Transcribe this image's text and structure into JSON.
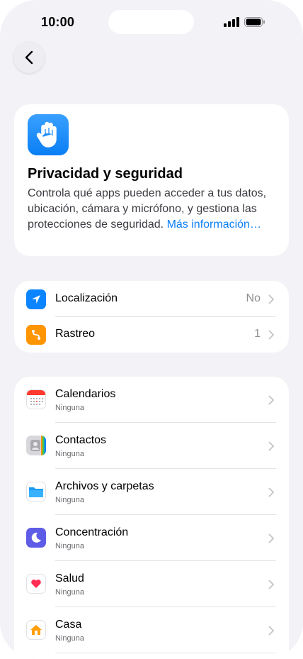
{
  "status": {
    "time": "10:00"
  },
  "hero": {
    "title": "Privacidad y seguridad",
    "description": "Controla qué apps pueden acceder a tus datos, ubicación, cámara y micrófono, y gestiona las protecciones de seguridad. ",
    "link": "Más información…"
  },
  "group1": [
    {
      "label": "Localización",
      "value": "No",
      "icon": "location-arrow-icon",
      "color": "#0a84ff"
    },
    {
      "label": "Rastreo",
      "value": "1",
      "icon": "tracking-icon",
      "color": "#ff9500"
    }
  ],
  "group2": [
    {
      "label": "Calendarios",
      "sub": "Ninguna",
      "icon": "calendar-icon"
    },
    {
      "label": "Contactos",
      "sub": "Ninguna",
      "icon": "contacts-icon"
    },
    {
      "label": "Archivos y carpetas",
      "sub": "Ninguna",
      "icon": "folder-icon"
    },
    {
      "label": "Concentración",
      "sub": "Ninguna",
      "icon": "moon-icon"
    },
    {
      "label": "Salud",
      "sub": "Ninguna",
      "icon": "heart-icon"
    },
    {
      "label": "Casa",
      "sub": "Ninguna",
      "icon": "home-icon"
    }
  ]
}
